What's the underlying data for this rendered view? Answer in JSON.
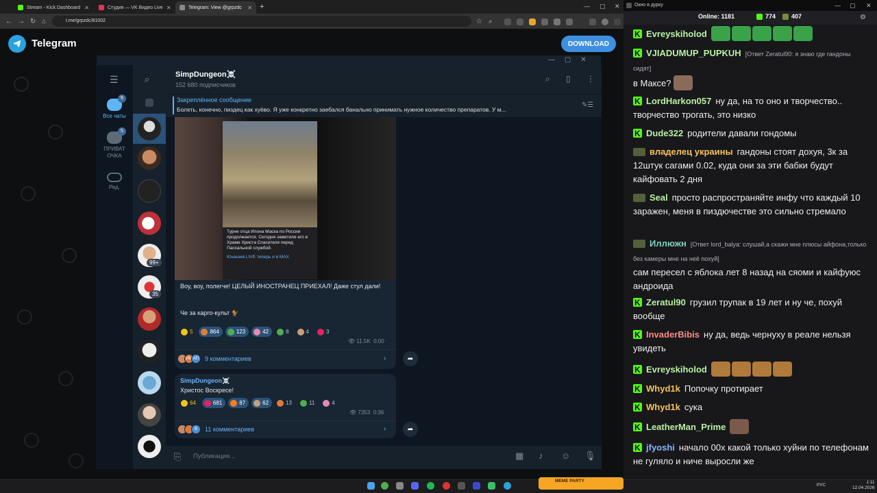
{
  "browser": {
    "tabs": [
      {
        "label": "Stream - Kick Dashboard",
        "color": "#53fc18"
      },
      {
        "label": "Студия — VK Видео Live",
        "color": "#e3335a"
      },
      {
        "label": "Telegram: View @grpzdc",
        "color": "#888888"
      }
    ],
    "url": "t.me/grpzdc/81002"
  },
  "telegram_web": {
    "title": "Telegram",
    "download_label": "DOWNLOAD"
  },
  "tg_app": {
    "left_nav": [
      {
        "label": "Все чаты",
        "badge": "9",
        "icon": "chats-icon"
      },
      {
        "label": "ПРИВАТ ОЧКА",
        "badge": "5",
        "icon": "folder-icon"
      },
      {
        "label": "Ред.",
        "badge": "",
        "icon": "edit-icon"
      }
    ],
    "chat_badges": [
      "99+",
      "35"
    ],
    "channel": {
      "name": "SimpDungeon☠️",
      "subscribers": "152 680 подписчиков"
    },
    "pinned": {
      "title": "Закреплённое сообщение",
      "text": "Болеть, конечно, пиздец как хуёво. Я уже конкретно заебался банально принимать нужное количество препаратов. У м..."
    },
    "post1": {
      "media_caption": "Турне отца Илона Маска по России продолжается. Сегодня заметили его в Храме Христа Спасителя перед Пасхальной службой.",
      "media_link": "Юнашев LIVE теперь и в MAX",
      "text1": "Воу, воу, полегче! ЦЕЛЫЙ ИНОСТРАНЕЦ ПРИЕХАЛ! Даже стул дали!",
      "text2": "Че за карго-культ 🐓",
      "reactions": [
        {
          "count": "5",
          "color": "#f5c518",
          "paid": true
        },
        {
          "count": "864",
          "color": "#e07b39"
        },
        {
          "count": "123",
          "color": "#4caf50"
        },
        {
          "count": "42",
          "color": "#e58bb0"
        },
        {
          "count": "8",
          "color": "#4caf50"
        },
        {
          "count": "4",
          "color": "#c89f7a"
        },
        {
          "count": "3",
          "color": "#e0245e"
        }
      ],
      "views": "11.5K",
      "time": "0:00",
      "comments": "9 комментариев",
      "commenter_initials": [
        "",
        "ИМ",
        "АП"
      ]
    },
    "post2": {
      "author": "SimpDungeon☠️",
      "text": "Христос Воскресе!",
      "reactions": [
        {
          "count": "64",
          "color": "#f5c518",
          "paid": true
        },
        {
          "count": "681",
          "color": "#e0245e"
        },
        {
          "count": "87",
          "color": "#ff7a1a"
        },
        {
          "count": "62",
          "color": "#c89f7a"
        },
        {
          "count": "13",
          "color": "#e07b39"
        },
        {
          "count": "11",
          "color": "#4caf50"
        },
        {
          "count": "4",
          "color": "#e58bb0"
        }
      ],
      "views": "7353",
      "time": "0:36",
      "comments": "11 комментариев",
      "commenter_initials": [
        "",
        "",
        "В"
      ]
    },
    "composer_placeholder": "Публикация..."
  },
  "chat_window": {
    "title": "Окно в дурку",
    "online_label": "Online:",
    "online": "1181",
    "stat_kick": "774",
    "stat_vk": "407",
    "messages": [
      {
        "user": "Evreyskiholod",
        "color": "#b9f0a3",
        "text": "",
        "emotes": 5,
        "emote_color": "#3aa34a"
      },
      {
        "user": "VJIADUMUP_PUPKUH",
        "color": "#b9f0a3",
        "reply": "[Ответ Zeratul90: я знаю где гандоны сидят]",
        "text": "в Максе?",
        "emotes": 1,
        "emote_color": "#8a6b5a"
      },
      {
        "user": "LordHarkon057",
        "color": "#b9f0a3",
        "text": "ну да, на то оно и творчество.. творчество трогать, это низко"
      },
      {
        "user": "Dude322",
        "color": "#b9f0a3",
        "text": "родители давали гондомы"
      },
      {
        "user": "владелец украины",
        "color": "#f5c25b",
        "text": "гандоны стоят дохуя, 3к за 12штук сагами 0.02, куда они за эти бабки будут кайфовать 2 дня",
        "rank": true
      },
      {
        "user": "Seal",
        "color": "#b9f0a3",
        "text": "просто распространяйте инфу что каждый 10 заражен, меня в пиздючестве это сильно стремало",
        "rank": true
      },
      {
        "user": "Иллюжн",
        "color": "#7fd3c0",
        "reply": "[Ответ lord_balya: слушай,а скажи мне плюсы айфона,только без камеры мне на неё похуй]",
        "text": "сам пересел с яблока лет 8 назад на сяоми и кайфуюс андроида",
        "rank": true
      },
      {
        "user": "Zeratul90",
        "color": "#b9f0a3",
        "text": "грузил трупак в 19 лет и ну че, похуй вообще"
      },
      {
        "user": "InvaderBibis",
        "color": "#ff8a80",
        "text": "ну да, ведь чернуху в реале нельзя увидеть"
      },
      {
        "user": "Evreyskiholod",
        "color": "#b9f0a3",
        "text": "",
        "emotes": 4,
        "emote_color": "#b07a3a"
      },
      {
        "user": "Whyd1k",
        "color": "#f5c25b",
        "text": "Попочку протирает"
      },
      {
        "user": "Whyd1k",
        "color": "#f5c25b",
        "text": "сука"
      },
      {
        "user": "LeatherMan_Prime",
        "color": "#b9f0a3",
        "text": "",
        "emotes": 1,
        "emote_color": "#7a5a4a"
      },
      {
        "user": "jfyoshi",
        "color": "#8ab4f8",
        "text": "начало 00х какой только хуйни по телефонам не гуляло и ниче выросли же"
      }
    ]
  },
  "taskbar": {
    "lang": "РУС",
    "time": "1:11",
    "date": "12.04.2026",
    "meme_party": "MEME PARTY"
  }
}
